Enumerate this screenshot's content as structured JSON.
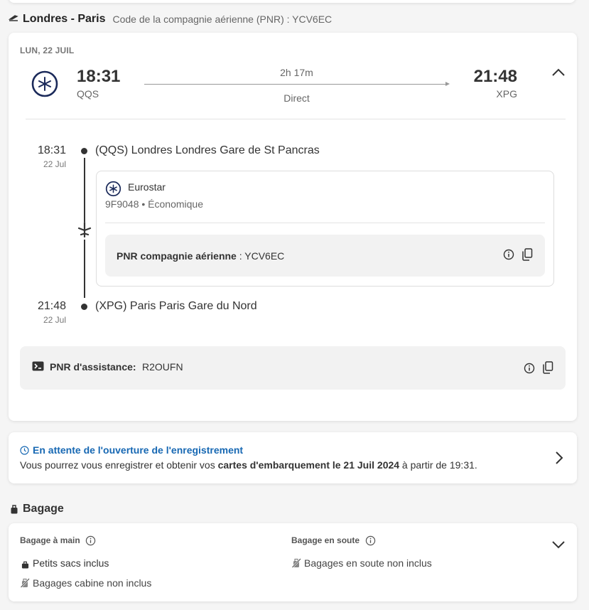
{
  "trip": {
    "route": "Londres - Paris",
    "pnr_line": "Code de la compagnie aérienne (PNR) : YCV6EC"
  },
  "segment": {
    "date_label": "LUN, 22 JUIL",
    "dep_time": "18:31",
    "dep_code": "QQS",
    "arr_time": "21:48",
    "arr_code": "XPG",
    "duration": "2h 17m",
    "stops": "Direct"
  },
  "timeline": {
    "dep_time": "18:31",
    "dep_date": "22 Jul",
    "dep_station": "(QQS) Londres Londres Gare de St Pancras",
    "arr_time": "21:48",
    "arr_date": "22 Jul",
    "arr_station": "(XPG) Paris Paris Gare du Nord"
  },
  "carrier": {
    "name": "Eurostar",
    "details": "9F9048 • Économique",
    "pnr_label": "PNR compagnie aérienne",
    "pnr_sep": " : ",
    "pnr_value": "YCV6EC"
  },
  "assist": {
    "label": "PNR d'assistance:",
    "value": "R2OUFN"
  },
  "checkin": {
    "title": "En attente de l'ouverture de l'enregistrement",
    "text_a": "Vous pourrez vous enregistrer et obtenir vos ",
    "text_b": "cartes d'embarquement le 21 Juil 2024",
    "text_c": " à partir de 19:31."
  },
  "baggage": {
    "title": "Bagage",
    "hand_title": "Bagage à main",
    "hold_title": "Bagage en soute",
    "hand_items": [
      "Petits sacs inclus",
      "Bagages cabine non inclus"
    ],
    "hold_items": [
      "Bagages en soute non inclus"
    ]
  },
  "colors": {
    "accent_blue": "#1768b3",
    "eurostar_navy": "#1b2a5a"
  }
}
